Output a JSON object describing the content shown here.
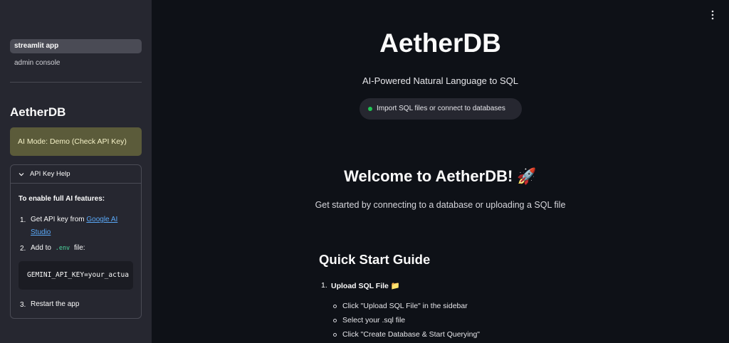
{
  "sidebar": {
    "nav": {
      "active": "streamlit app",
      "inactive": "admin console"
    },
    "title": "AetherDB",
    "ai_mode": "AI Mode: Demo (Check API Key)",
    "expander": {
      "label": "API Key Help",
      "heading": "To enable full AI features:",
      "steps": [
        {
          "num": "1.",
          "prefix": "Get API key from ",
          "link": "Google AI Studio"
        },
        {
          "num": "2.",
          "prefix": "Add to ",
          "code": ".env",
          "suffix": " file:"
        },
        {
          "num": "3.",
          "text": "Restart the app"
        }
      ],
      "code_block": "GEMINI_API_KEY=your_actua"
    }
  },
  "main": {
    "title": "AetherDB",
    "subtitle": "AI-Powered Natural Language to SQL",
    "pill": "Import SQL files or connect to databases",
    "welcome": "Welcome to AetherDB! 🚀",
    "welcome_sub": "Get started by connecting to a database or uploading a SQL file",
    "quick_start": {
      "title": "Quick Start Guide",
      "step_num": "1.",
      "step_label": "Upload SQL File 📁",
      "bullets": [
        "Click \"Upload SQL File\" in the sidebar",
        "Select your .sql file",
        "Click \"Create Database & Start Querying\""
      ]
    }
  },
  "colors": {
    "sidebar_bg": "#262730",
    "main_bg": "#0e1117",
    "ai_mode_bg": "#5b5b3a",
    "link": "#5aa8f7",
    "status_dot": "#21c354"
  },
  "icons": {
    "expander": "chevron-down-icon",
    "menu": "kebab-menu-icon"
  }
}
